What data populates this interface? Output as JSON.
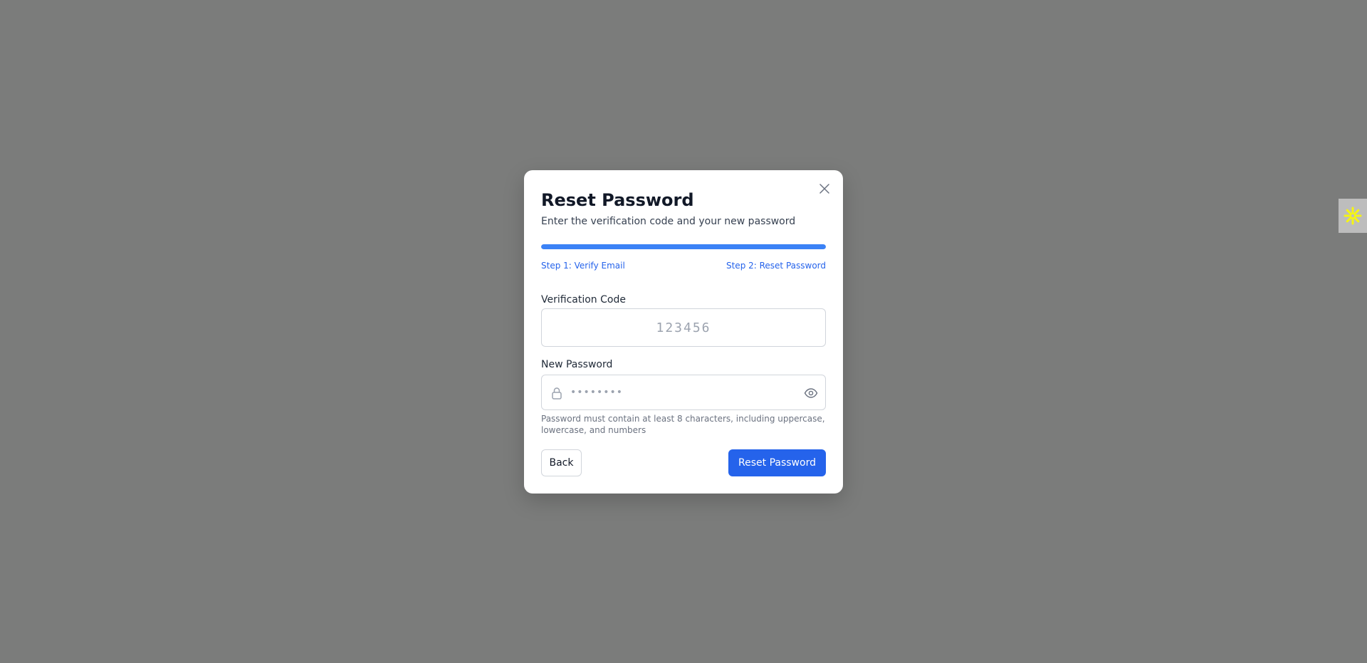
{
  "dialog": {
    "title": "Reset Password",
    "subtitle": "Enter the verification code and your new password",
    "progress_percent": 100,
    "steps": {
      "step1": "Step 1: Verify Email",
      "step2": "Step 2: Reset Password"
    },
    "verification": {
      "label": "Verification Code",
      "placeholder": "123456"
    },
    "new_password": {
      "label": "New Password",
      "placeholder": "••••••••",
      "hint": "Password must contain at least 8 characters, including uppercase, lowercase, and numbers"
    },
    "buttons": {
      "back": "Back",
      "submit": "Reset Password"
    },
    "icons": {
      "close": "close-icon",
      "lock": "lock-icon",
      "eye": "eye-icon"
    }
  },
  "side_widget": {
    "icon": "sparkle-icon",
    "color": "#f5f514"
  },
  "colors": {
    "overlay": "#7b7c7b",
    "primary": "#2563eb",
    "progress": "#3b82f6"
  }
}
